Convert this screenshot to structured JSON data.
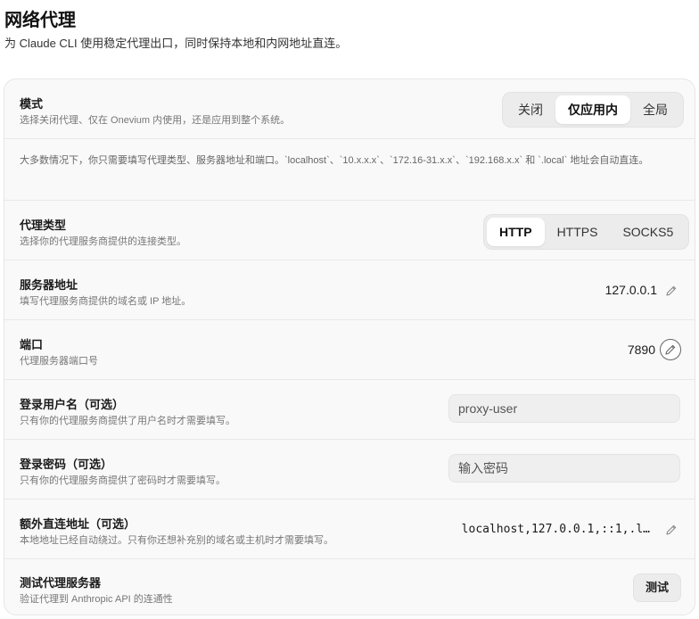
{
  "page": {
    "title": "网络代理",
    "subtitle": "为 Claude CLI 使用稳定代理出口，同时保持本地和内网地址直连。"
  },
  "mode": {
    "title": "模式",
    "desc": "选择关闭代理、仅在 Onevium 内使用，还是应用到整个系统。",
    "options": [
      "关闭",
      "仅应用内",
      "全局"
    ],
    "selected": "仅应用内"
  },
  "note": "大多数情况下，你只需要填写代理类型、服务器地址和端口。`localhost`、`10.x.x.x`、`172.16-31.x.x`、`192.168.x.x` 和 `.local` 地址会自动直连。",
  "proxy_type": {
    "title": "代理类型",
    "desc": "选择你的代理服务商提供的连接类型。",
    "options": [
      "HTTP",
      "HTTPS",
      "SOCKS5"
    ],
    "selected": "HTTP"
  },
  "server": {
    "title": "服务器地址",
    "desc": "填写代理服务商提供的域名或 IP 地址。",
    "value": "127.0.0.1"
  },
  "port": {
    "title": "端口",
    "desc": "代理服务器端口号",
    "value": "7890"
  },
  "username": {
    "title": "登录用户名（可选）",
    "desc": "只有你的代理服务商提供了用户名时才需要填写。",
    "placeholder": "proxy-user"
  },
  "password": {
    "title": "登录密码（可选）",
    "desc": "只有你的代理服务商提供了密码时才需要填写。",
    "placeholder": "输入密码"
  },
  "bypass": {
    "title": "额外直连地址（可选）",
    "desc": "本地地址已经自动绕过。只有你还想补充别的域名或主机时才需要填写。",
    "value": "localhost,127.0.0.1,::1,.l…"
  },
  "test": {
    "title": "测试代理服务器",
    "desc": "验证代理到 Anthropic API 的连通性",
    "button_label": "测试"
  },
  "icons": {
    "edit": "pencil-icon"
  }
}
